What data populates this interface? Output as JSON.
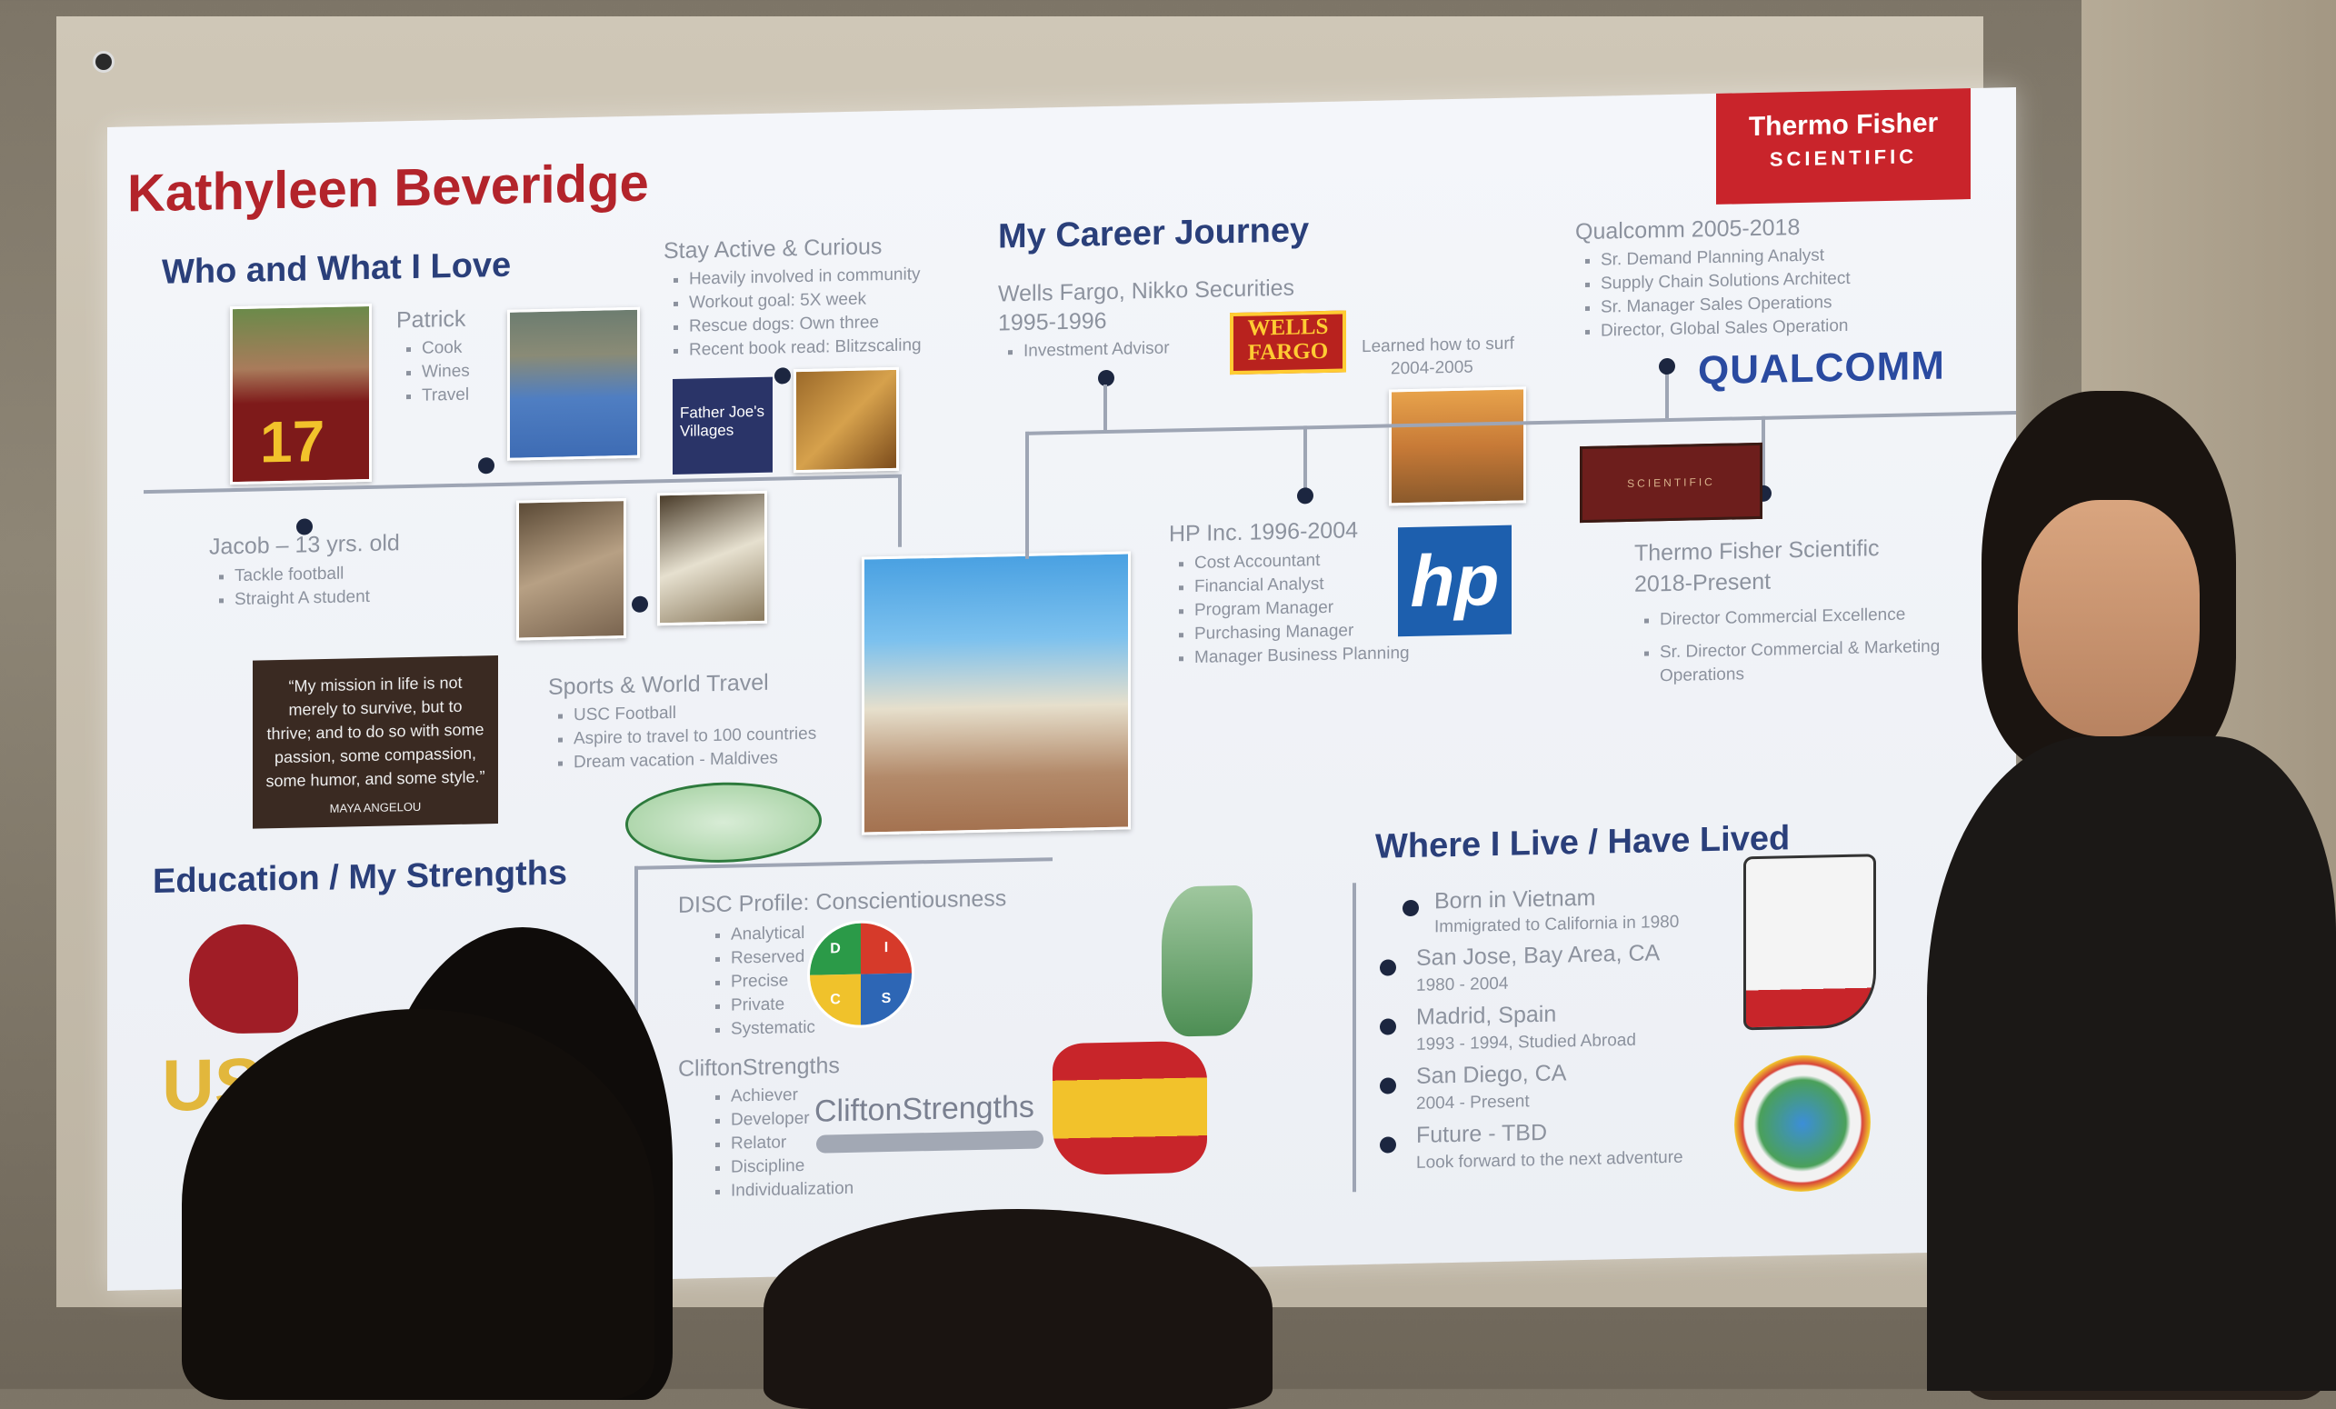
{
  "slide": {
    "name": "Kathyleen Beveridge",
    "logo_line1": "Thermo Fisher",
    "logo_line2": "SCIENTIFIC",
    "who": {
      "title": "Who and What I Love",
      "patrick": "Patrick",
      "patrick_items": [
        "Cook",
        "Wines",
        "Travel"
      ],
      "jacob": "Jacob – 13 yrs. old",
      "jacob_items": [
        "Tackle football",
        "Straight A student"
      ],
      "stay_active": "Stay Active & Curious",
      "stay_items": [
        "Heavily involved in community",
        "Workout goal: 5X week",
        "Rescue dogs: Own three",
        "Recent book read: Blitzscaling"
      ],
      "sports": "Sports & World Travel",
      "sports_items": [
        "USC Football",
        "Aspire to travel to 100 countries",
        "Dream vacation - Maldives"
      ],
      "badge_jersey": "17",
      "badge_villages": "Father Joe's Villages",
      "quote": "“My mission in life is not merely to survive, but to thrive; and to do so with some passion, some compassion, some humor, and some style.”",
      "quote_author": "MAYA ANGELOU"
    },
    "career": {
      "title": "My Career Journey",
      "wells": "Wells Fargo, Nikko Securities",
      "wells_years": "1995-1996",
      "wells_items": [
        "Investment Advisor"
      ],
      "wells_logo": "WELLS FARGO",
      "surf": "Learned how to surf",
      "surf_years": "2004-2005",
      "hp": "HP Inc. 1996-2004",
      "hp_items": [
        "Cost Accountant",
        "Financial Analyst",
        "Program Manager",
        "Purchasing Manager",
        "Manager Business Planning"
      ],
      "hp_logo": "hp",
      "qualcomm": "Qualcomm 2005-2018",
      "qualcomm_items": [
        "Sr. Demand Planning Analyst",
        "Supply Chain Solutions Architect",
        "Sr. Manager Sales Operations",
        "Director, Global Sales Operation"
      ],
      "qualcomm_logo": "QUALCOMM",
      "thermo": "Thermo Fisher Scientific",
      "thermo_years": "2018-Present",
      "thermo_items": [
        "Director Commercial Excellence",
        "Sr. Director Commercial & Marketing Operations"
      ],
      "thermo_sign": "SCIENTIFIC"
    },
    "education": {
      "title": "Education / My Strengths",
      "usc": "USC",
      "disc": "DISC Profile: Conscientiousness",
      "disc_items": [
        "Analytical",
        "Reserved",
        "Precise",
        "Private",
        "Systematic"
      ],
      "disc_letters": [
        "D",
        "I",
        "C",
        "S"
      ],
      "clifton": "CliftonStrengths",
      "clifton_items": [
        "Achiever",
        "Developer",
        "Relator",
        "Discipline",
        "Individualization"
      ],
      "clifton_logo": "CliftonStrengths"
    },
    "live": {
      "title": "Where I Live / Have Lived",
      "places": [
        {
          "place": "Born in Vietnam",
          "detail": "Immigrated to California in 1980"
        },
        {
          "place": "San Jose, Bay Area, CA",
          "detail": "1980 - 2004"
        },
        {
          "place": "Madrid, Spain",
          "detail": "1993 - 1994, Studied Abroad"
        },
        {
          "place": "San Diego, CA",
          "detail": "2004 - Present"
        },
        {
          "place": "Future - TBD",
          "detail": "Look forward to the next adventure"
        }
      ]
    }
  },
  "colors": {
    "title_red": "#b3242b",
    "heading_navy": "#2a3f7a",
    "thermo_red": "#c9242b",
    "hp_blue": "#1d5fae"
  },
  "icons": [
    "usc-trojan-logo",
    "world-map-icon",
    "vietnam-map-icon",
    "spain-flag-map-icon",
    "california-flag-map-icon",
    "globe-people-icon"
  ]
}
